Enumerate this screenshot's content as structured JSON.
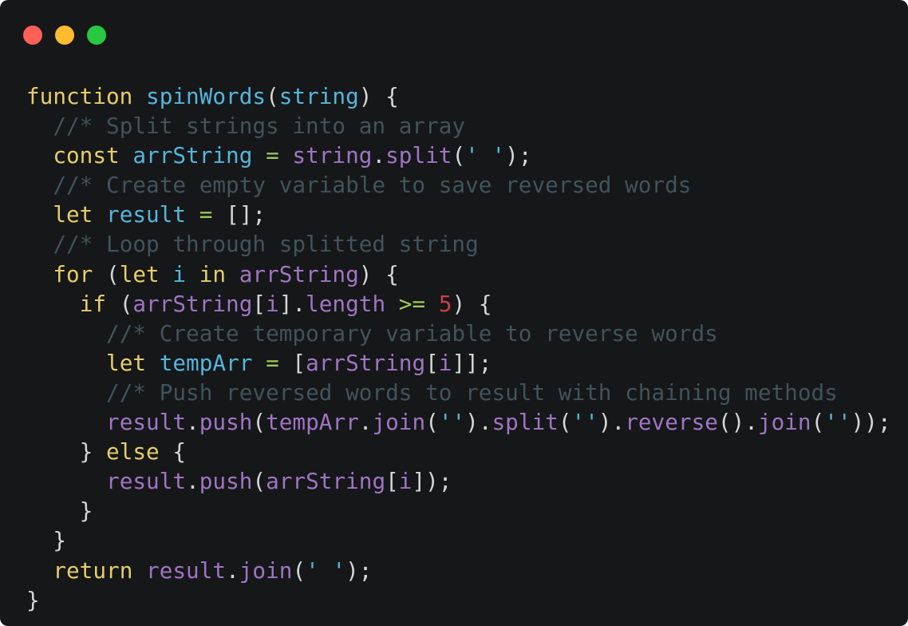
{
  "window": {
    "controls": [
      {
        "name": "close",
        "color": "#ff5f57"
      },
      {
        "name": "minimize",
        "color": "#febc2e"
      },
      {
        "name": "maximize",
        "color": "#28c840"
      }
    ]
  },
  "theme": {
    "background": "#151718",
    "text": "#d4d7d6",
    "keyword": "#e6cd69",
    "function": "#55b5db",
    "property": "#a074c4",
    "string": "#55b5db",
    "number": "#cd3f45",
    "operator": "#9fca56",
    "comment": "#41535b"
  },
  "code": {
    "language": "javascript",
    "lines": [
      [
        [
          "keyword",
          "function"
        ],
        [
          "punct",
          " "
        ],
        [
          "func",
          "spinWords"
        ],
        [
          "punct",
          "("
        ],
        [
          "var",
          "string"
        ],
        [
          "punct",
          ") {"
        ]
      ],
      [
        [
          "punct",
          "  "
        ],
        [
          "comment",
          "//* Split strings into an array"
        ]
      ],
      [
        [
          "punct",
          "  "
        ],
        [
          "keyword",
          "const"
        ],
        [
          "punct",
          " "
        ],
        [
          "var",
          "arrString"
        ],
        [
          "punct",
          " "
        ],
        [
          "op",
          "="
        ],
        [
          "punct",
          " "
        ],
        [
          "prop",
          "string"
        ],
        [
          "punct",
          "."
        ],
        [
          "prop",
          "split"
        ],
        [
          "punct",
          "("
        ],
        [
          "string",
          "' '"
        ],
        [
          "punct",
          ");"
        ]
      ],
      [
        [
          "punct",
          "  "
        ],
        [
          "comment",
          "//* Create empty variable to save reversed words"
        ]
      ],
      [
        [
          "punct",
          "  "
        ],
        [
          "keyword",
          "let"
        ],
        [
          "punct",
          " "
        ],
        [
          "var",
          "result"
        ],
        [
          "punct",
          " "
        ],
        [
          "op",
          "="
        ],
        [
          "punct",
          " [];"
        ]
      ],
      [
        [
          "punct",
          "  "
        ],
        [
          "comment",
          "//* Loop through splitted string"
        ]
      ],
      [
        [
          "punct",
          "  "
        ],
        [
          "keyword",
          "for"
        ],
        [
          "punct",
          " ("
        ],
        [
          "keyword",
          "let"
        ],
        [
          "punct",
          " "
        ],
        [
          "var",
          "i"
        ],
        [
          "punct",
          " "
        ],
        [
          "keyword",
          "in"
        ],
        [
          "punct",
          " "
        ],
        [
          "prop",
          "arrString"
        ],
        [
          "punct",
          ") {"
        ]
      ],
      [
        [
          "punct",
          "    "
        ],
        [
          "keyword",
          "if"
        ],
        [
          "punct",
          " ("
        ],
        [
          "prop",
          "arrString"
        ],
        [
          "punct",
          "["
        ],
        [
          "prop",
          "i"
        ],
        [
          "punct",
          "]."
        ],
        [
          "prop",
          "length"
        ],
        [
          "punct",
          " "
        ],
        [
          "op",
          ">="
        ],
        [
          "punct",
          " "
        ],
        [
          "number",
          "5"
        ],
        [
          "punct",
          ") {"
        ]
      ],
      [
        [
          "punct",
          "      "
        ],
        [
          "comment",
          "//* Create temporary variable to reverse words"
        ]
      ],
      [
        [
          "punct",
          "      "
        ],
        [
          "keyword",
          "let"
        ],
        [
          "punct",
          " "
        ],
        [
          "var",
          "tempArr"
        ],
        [
          "punct",
          " "
        ],
        [
          "op",
          "="
        ],
        [
          "punct",
          " ["
        ],
        [
          "prop",
          "arrString"
        ],
        [
          "punct",
          "["
        ],
        [
          "prop",
          "i"
        ],
        [
          "punct",
          "]];"
        ]
      ],
      [
        [
          "punct",
          "      "
        ],
        [
          "comment",
          "//* Push reversed words to result with chaining methods"
        ]
      ],
      [
        [
          "punct",
          "      "
        ],
        [
          "prop",
          "result"
        ],
        [
          "punct",
          "."
        ],
        [
          "prop",
          "push"
        ],
        [
          "punct",
          "("
        ],
        [
          "prop",
          "tempArr"
        ],
        [
          "punct",
          "."
        ],
        [
          "prop",
          "join"
        ],
        [
          "punct",
          "("
        ],
        [
          "string",
          "''"
        ],
        [
          "punct",
          ")."
        ],
        [
          "prop",
          "split"
        ],
        [
          "punct",
          "("
        ],
        [
          "string",
          "''"
        ],
        [
          "punct",
          ")."
        ],
        [
          "prop",
          "reverse"
        ],
        [
          "punct",
          "()."
        ],
        [
          "prop",
          "join"
        ],
        [
          "punct",
          "("
        ],
        [
          "string",
          "''"
        ],
        [
          "punct",
          "));"
        ]
      ],
      [
        [
          "punct",
          "    } "
        ],
        [
          "keyword",
          "else"
        ],
        [
          "punct",
          " {"
        ]
      ],
      [
        [
          "punct",
          "      "
        ],
        [
          "prop",
          "result"
        ],
        [
          "punct",
          "."
        ],
        [
          "prop",
          "push"
        ],
        [
          "punct",
          "("
        ],
        [
          "prop",
          "arrString"
        ],
        [
          "punct",
          "["
        ],
        [
          "prop",
          "i"
        ],
        [
          "punct",
          "]);"
        ]
      ],
      [
        [
          "punct",
          "    }"
        ]
      ],
      [
        [
          "punct",
          "  }"
        ]
      ],
      [
        [
          "punct",
          "  "
        ],
        [
          "keyword",
          "return"
        ],
        [
          "punct",
          " "
        ],
        [
          "prop",
          "result"
        ],
        [
          "punct",
          "."
        ],
        [
          "prop",
          "join"
        ],
        [
          "punct",
          "("
        ],
        [
          "string",
          "' '"
        ],
        [
          "punct",
          ");"
        ]
      ],
      [
        [
          "punct",
          "}"
        ]
      ]
    ]
  }
}
